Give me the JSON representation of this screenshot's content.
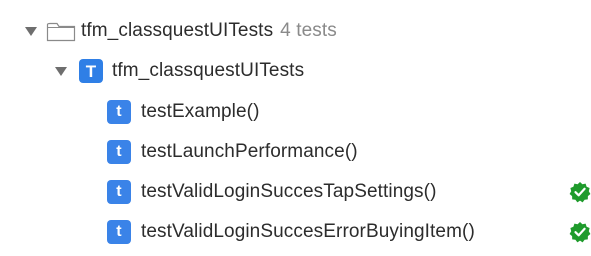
{
  "tree": {
    "root": {
      "label": "tfm_classquestUITests",
      "count": "4 tests",
      "icon": "folder-icon",
      "expanded": true
    },
    "group": {
      "label": "tfm_classquestUITests",
      "badge": "T",
      "icon": "test-bundle-icon",
      "expanded": true
    },
    "tests": [
      {
        "label": "testExample()",
        "badge": "t",
        "status": ""
      },
      {
        "label": "testLaunchPerformance()",
        "badge": "t",
        "status": ""
      },
      {
        "label": "testValidLoginSuccesTapSettings()",
        "badge": "t",
        "status": "passed"
      },
      {
        "label": "testValidLoginSuccesErrorBuyingItem()",
        "badge": "t",
        "status": "passed"
      }
    ]
  },
  "colors": {
    "badge": "#2f7fe6",
    "pass": "#1f9b2c",
    "text": "#2c2c2c",
    "muted": "#8a8a8a"
  }
}
